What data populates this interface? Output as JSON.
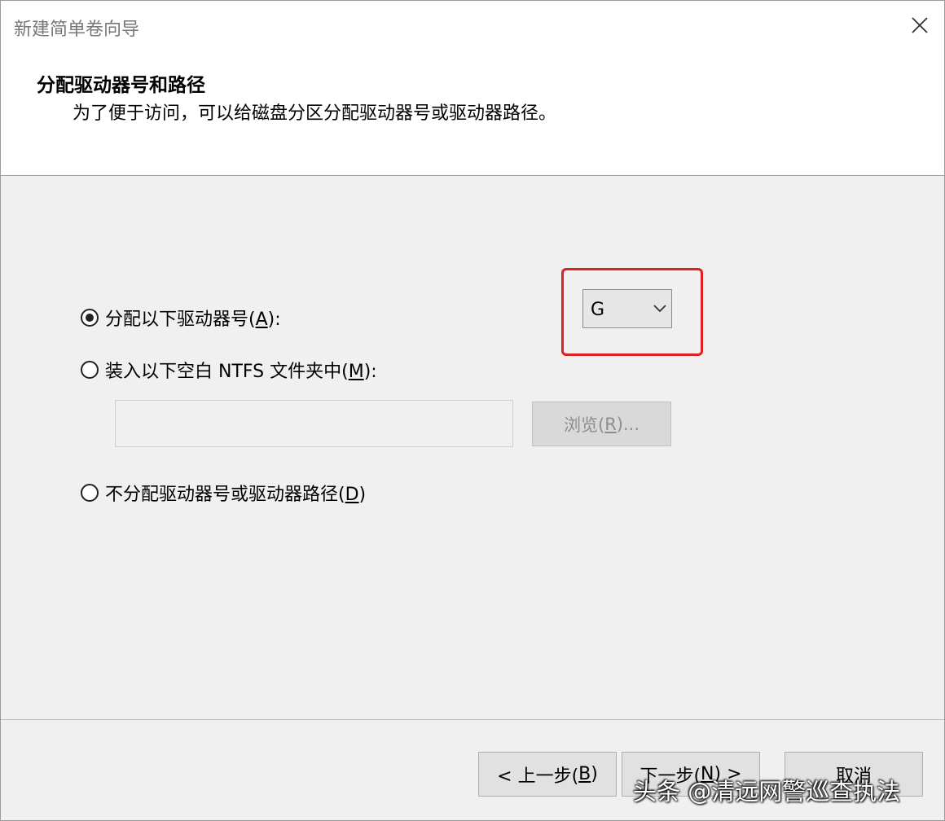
{
  "window": {
    "title": "新建简单卷向导"
  },
  "header": {
    "title": "分配驱动器号和路径",
    "subtitle": "为了便于访问，可以给磁盘分区分配驱动器号或驱动器路径。"
  },
  "options": {
    "assign_letter": {
      "label": "分配以下驱动器号(",
      "accel": "A",
      "suffix": "):",
      "selected": true
    },
    "mount_folder": {
      "label": "装入以下空白 NTFS 文件夹中(",
      "accel": "M",
      "suffix": "):",
      "selected": false
    },
    "no_assign": {
      "label": "不分配驱动器号或驱动器路径(",
      "accel": "D",
      "suffix": ")",
      "selected": false
    }
  },
  "drive_select": {
    "value": "G"
  },
  "path_input": {
    "value": ""
  },
  "browse": {
    "label": "浏览(",
    "accel": "R",
    "suffix": ")..."
  },
  "buttons": {
    "back": {
      "prefix": "< 上一步(",
      "accel": "B",
      "suffix": ")"
    },
    "next": {
      "prefix": "下一步(",
      "accel": "N",
      "suffix": ") >"
    },
    "cancel": "取消"
  },
  "watermark": "头条 @清远网警巡查执法",
  "colors": {
    "highlight": "#e02020"
  }
}
